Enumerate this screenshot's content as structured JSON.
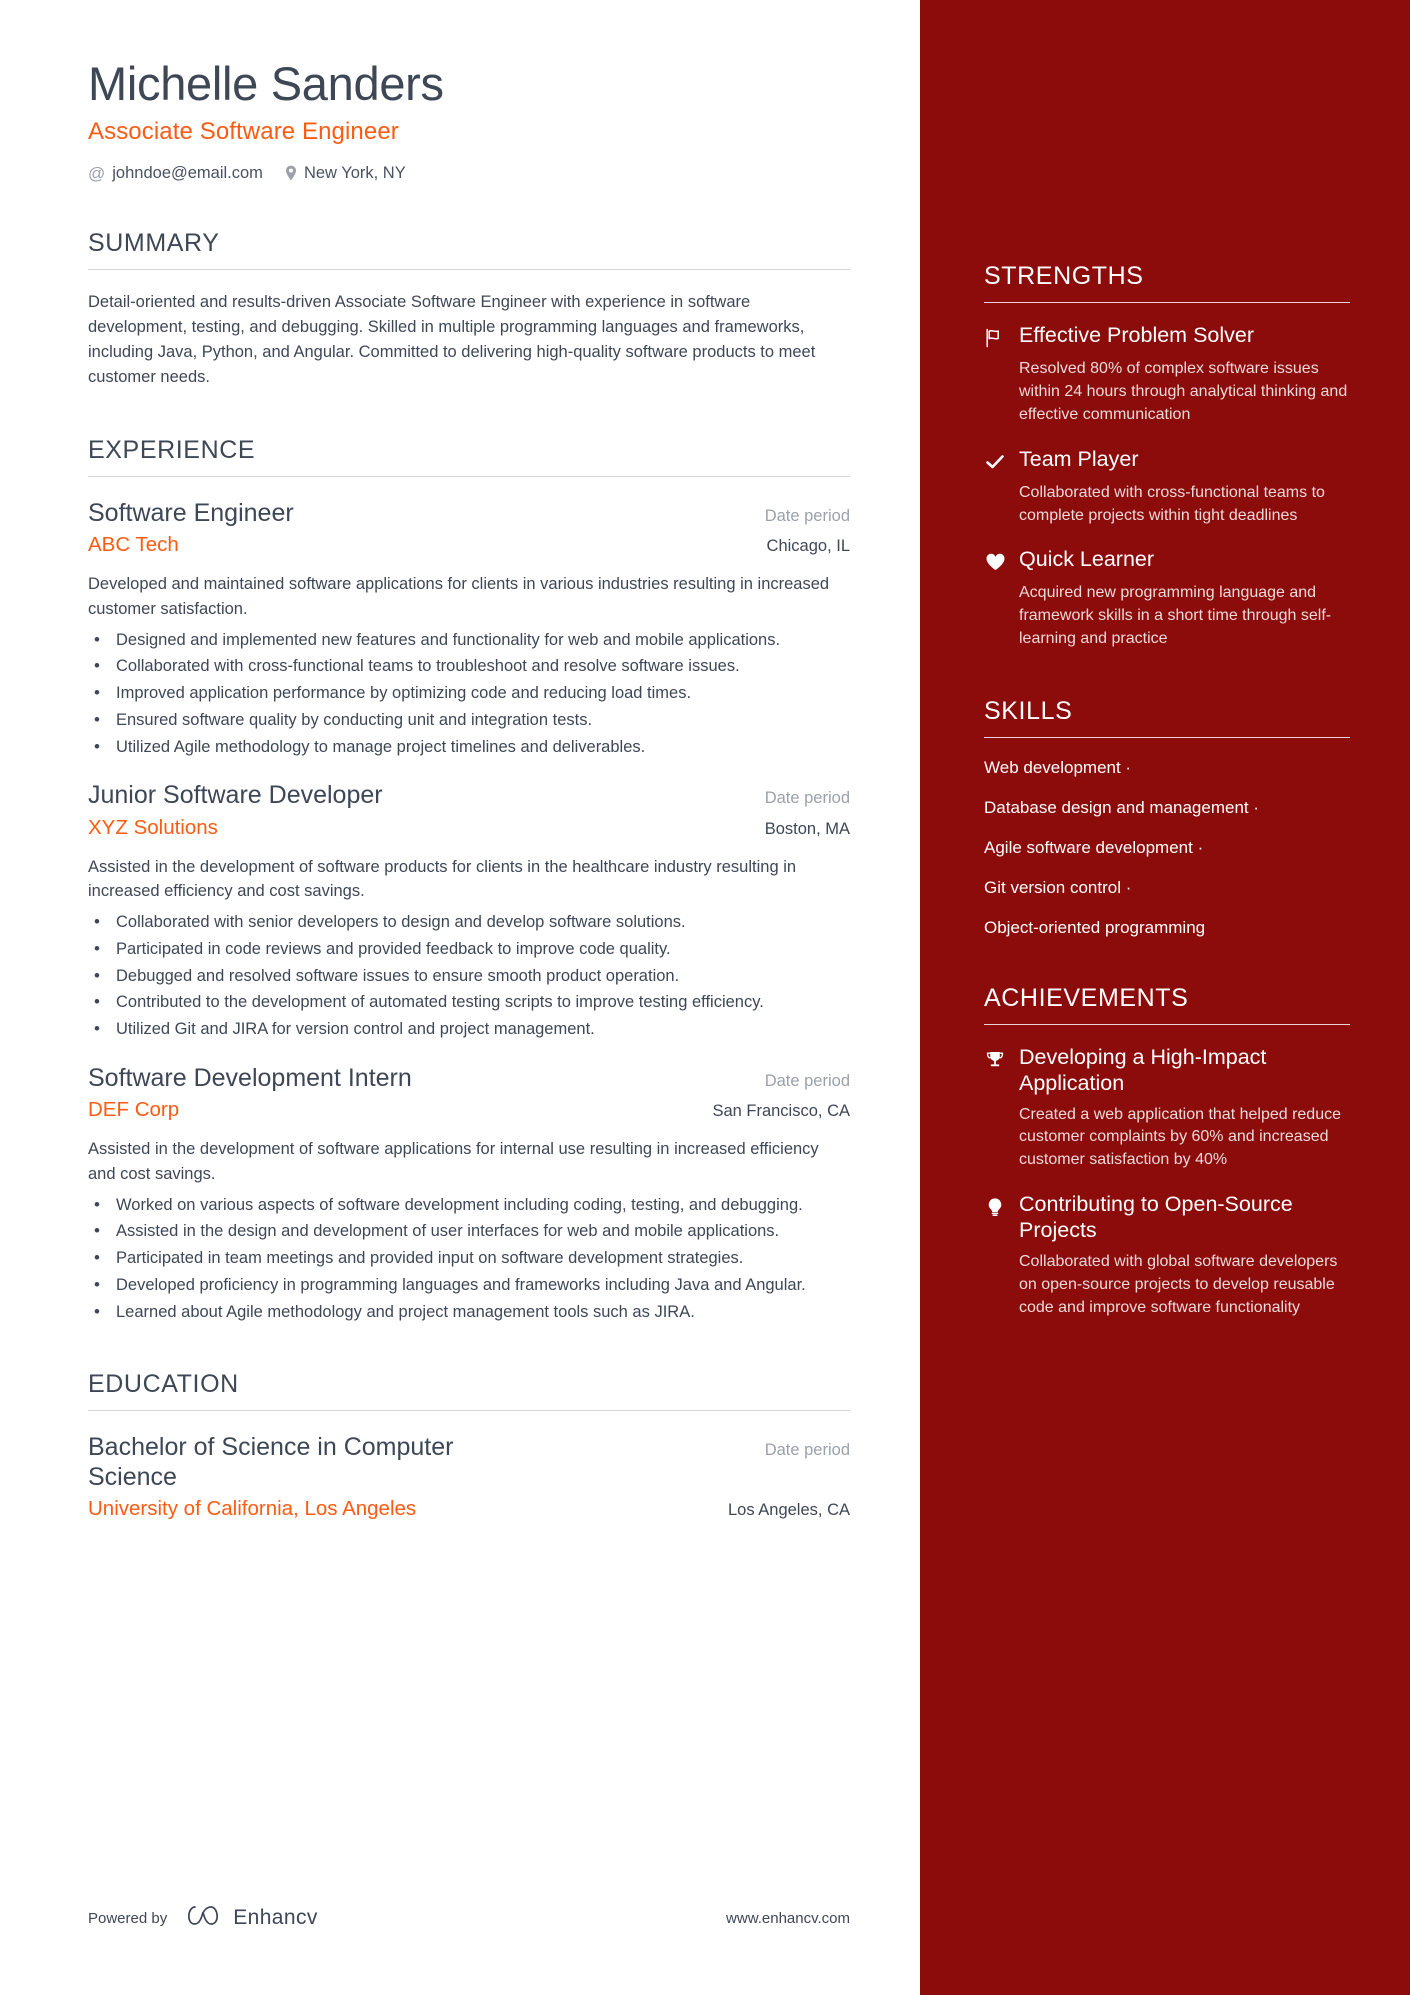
{
  "header": {
    "name": "Michelle Sanders",
    "job_title": "Associate Software Engineer",
    "email": "johndoe@email.com",
    "location": "New York, NY",
    "email_icon": "at-icon",
    "location_icon": "map-pin-icon"
  },
  "summary": {
    "title": "SUMMARY",
    "text": "Detail-oriented and results-driven Associate Software Engineer with experience in software development, testing, and debugging. Skilled in multiple programming languages and frameworks, including Java, Python, and Angular. Committed to delivering high-quality software products to meet customer needs."
  },
  "experience": {
    "title": "EXPERIENCE",
    "entries": [
      {
        "role": "Software Engineer",
        "date": "Date period",
        "organization": "ABC Tech",
        "location": "Chicago, IL",
        "description": "Developed and maintained software applications for clients in various industries resulting in increased customer satisfaction.",
        "bullets": [
          "Designed and implemented new features and functionality for web and mobile applications.",
          "Collaborated with cross-functional teams to troubleshoot and resolve software issues.",
          "Improved application performance by optimizing code and reducing load times.",
          "Ensured software quality by conducting unit and integration tests.",
          "Utilized Agile methodology to manage project timelines and deliverables."
        ]
      },
      {
        "role": "Junior Software Developer",
        "date": "Date period",
        "organization": "XYZ Solutions",
        "location": "Boston, MA",
        "description": "Assisted in the development of software products for clients in the healthcare industry resulting in increased efficiency and cost savings.",
        "bullets": [
          "Collaborated with senior developers to design and develop software solutions.",
          "Participated in code reviews and provided feedback to improve code quality.",
          "Debugged and resolved software issues to ensure smooth product operation.",
          "Contributed to the development of automated testing scripts to improve testing efficiency.",
          "Utilized Git and JIRA for version control and project management."
        ]
      },
      {
        "role": "Software Development Intern",
        "date": "Date period",
        "organization": "DEF Corp",
        "location": "San Francisco, CA",
        "description": "Assisted in the development of software applications for internal use resulting in increased efficiency and cost savings.",
        "bullets": [
          "Worked on various aspects of software development including coding, testing, and debugging.",
          "Assisted in the design and development of user interfaces for web and mobile applications.",
          "Participated in team meetings and provided input on software development strategies.",
          "Developed proficiency in programming languages and frameworks including Java and Angular.",
          "Learned about Agile methodology and project management tools such as JIRA."
        ]
      }
    ]
  },
  "education": {
    "title": "EDUCATION",
    "entries": [
      {
        "degree": "Bachelor of Science in Computer Science",
        "date": "Date period",
        "institution": "University of California, Los Angeles",
        "location": "Los Angeles, CA"
      }
    ]
  },
  "footer": {
    "powered_by": "Powered by",
    "brand": "Enhancv",
    "website": "www.enhancv.com",
    "logo_icon": "enhancv-logo-icon"
  },
  "strengths": {
    "title": "STRENGTHS",
    "items": [
      {
        "icon": "flag-icon",
        "title": "Effective Problem Solver",
        "description": "Resolved 80% of complex software issues within 24 hours through analytical thinking and effective communication"
      },
      {
        "icon": "check-icon",
        "title": "Team Player",
        "description": "Collaborated with cross-functional teams to complete projects within tight deadlines"
      },
      {
        "icon": "heart-icon",
        "title": "Quick Learner",
        "description": "Acquired new programming language and framework skills in a short time through self-learning and practice"
      }
    ]
  },
  "skills": {
    "title": "SKILLS",
    "items": [
      "Web development ·",
      "Database design and management ·",
      "Agile software development ·",
      "Git version control ·",
      "Object-oriented programming"
    ]
  },
  "achievements": {
    "title": "ACHIEVEMENTS",
    "items": [
      {
        "icon": "trophy-icon",
        "title": "Developing a High-Impact Application",
        "description": "Created a web application that helped reduce customer complaints by 60% and increased customer satisfaction by 40%"
      },
      {
        "icon": "lightbulb-icon",
        "title": "Contributing to Open-Source Projects",
        "description": "Collaborated with global software developers on open-source projects to develop reusable code and improve software functionality"
      }
    ]
  },
  "colors": {
    "accent_orange": "#ff5b13",
    "sidebar_red": "#8c0b0b",
    "text_dark": "#3e4756",
    "muted_gray": "#9aa1ab"
  }
}
